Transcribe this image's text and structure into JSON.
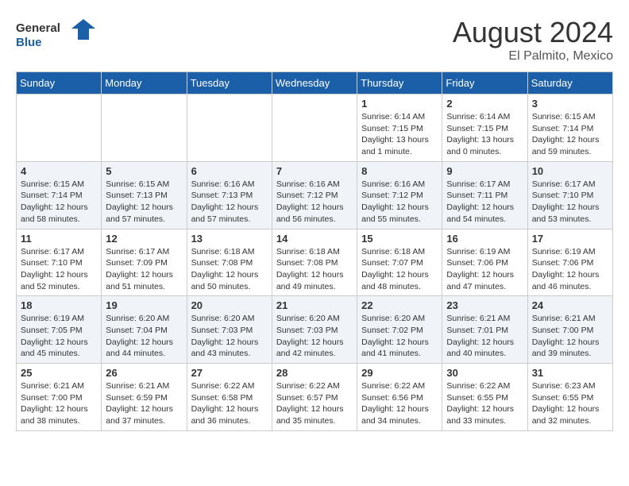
{
  "header": {
    "logo_text_general": "General",
    "logo_text_blue": "Blue",
    "month_year": "August 2024",
    "location": "El Palmito, Mexico"
  },
  "weekdays": [
    "Sunday",
    "Monday",
    "Tuesday",
    "Wednesday",
    "Thursday",
    "Friday",
    "Saturday"
  ],
  "weeks": [
    [
      {
        "day": "",
        "sunrise": "",
        "sunset": "",
        "daylight": ""
      },
      {
        "day": "",
        "sunrise": "",
        "sunset": "",
        "daylight": ""
      },
      {
        "day": "",
        "sunrise": "",
        "sunset": "",
        "daylight": ""
      },
      {
        "day": "",
        "sunrise": "",
        "sunset": "",
        "daylight": ""
      },
      {
        "day": "1",
        "sunrise": "Sunrise: 6:14 AM",
        "sunset": "Sunset: 7:15 PM",
        "daylight": "Daylight: 13 hours and 1 minute."
      },
      {
        "day": "2",
        "sunrise": "Sunrise: 6:14 AM",
        "sunset": "Sunset: 7:15 PM",
        "daylight": "Daylight: 13 hours and 0 minutes."
      },
      {
        "day": "3",
        "sunrise": "Sunrise: 6:15 AM",
        "sunset": "Sunset: 7:14 PM",
        "daylight": "Daylight: 12 hours and 59 minutes."
      }
    ],
    [
      {
        "day": "4",
        "sunrise": "Sunrise: 6:15 AM",
        "sunset": "Sunset: 7:14 PM",
        "daylight": "Daylight: 12 hours and 58 minutes."
      },
      {
        "day": "5",
        "sunrise": "Sunrise: 6:15 AM",
        "sunset": "Sunset: 7:13 PM",
        "daylight": "Daylight: 12 hours and 57 minutes."
      },
      {
        "day": "6",
        "sunrise": "Sunrise: 6:16 AM",
        "sunset": "Sunset: 7:13 PM",
        "daylight": "Daylight: 12 hours and 57 minutes."
      },
      {
        "day": "7",
        "sunrise": "Sunrise: 6:16 AM",
        "sunset": "Sunset: 7:12 PM",
        "daylight": "Daylight: 12 hours and 56 minutes."
      },
      {
        "day": "8",
        "sunrise": "Sunrise: 6:16 AM",
        "sunset": "Sunset: 7:12 PM",
        "daylight": "Daylight: 12 hours and 55 minutes."
      },
      {
        "day": "9",
        "sunrise": "Sunrise: 6:17 AM",
        "sunset": "Sunset: 7:11 PM",
        "daylight": "Daylight: 12 hours and 54 minutes."
      },
      {
        "day": "10",
        "sunrise": "Sunrise: 6:17 AM",
        "sunset": "Sunset: 7:10 PM",
        "daylight": "Daylight: 12 hours and 53 minutes."
      }
    ],
    [
      {
        "day": "11",
        "sunrise": "Sunrise: 6:17 AM",
        "sunset": "Sunset: 7:10 PM",
        "daylight": "Daylight: 12 hours and 52 minutes."
      },
      {
        "day": "12",
        "sunrise": "Sunrise: 6:17 AM",
        "sunset": "Sunset: 7:09 PM",
        "daylight": "Daylight: 12 hours and 51 minutes."
      },
      {
        "day": "13",
        "sunrise": "Sunrise: 6:18 AM",
        "sunset": "Sunset: 7:08 PM",
        "daylight": "Daylight: 12 hours and 50 minutes."
      },
      {
        "day": "14",
        "sunrise": "Sunrise: 6:18 AM",
        "sunset": "Sunset: 7:08 PM",
        "daylight": "Daylight: 12 hours and 49 minutes."
      },
      {
        "day": "15",
        "sunrise": "Sunrise: 6:18 AM",
        "sunset": "Sunset: 7:07 PM",
        "daylight": "Daylight: 12 hours and 48 minutes."
      },
      {
        "day": "16",
        "sunrise": "Sunrise: 6:19 AM",
        "sunset": "Sunset: 7:06 PM",
        "daylight": "Daylight: 12 hours and 47 minutes."
      },
      {
        "day": "17",
        "sunrise": "Sunrise: 6:19 AM",
        "sunset": "Sunset: 7:06 PM",
        "daylight": "Daylight: 12 hours and 46 minutes."
      }
    ],
    [
      {
        "day": "18",
        "sunrise": "Sunrise: 6:19 AM",
        "sunset": "Sunset: 7:05 PM",
        "daylight": "Daylight: 12 hours and 45 minutes."
      },
      {
        "day": "19",
        "sunrise": "Sunrise: 6:20 AM",
        "sunset": "Sunset: 7:04 PM",
        "daylight": "Daylight: 12 hours and 44 minutes."
      },
      {
        "day": "20",
        "sunrise": "Sunrise: 6:20 AM",
        "sunset": "Sunset: 7:03 PM",
        "daylight": "Daylight: 12 hours and 43 minutes."
      },
      {
        "day": "21",
        "sunrise": "Sunrise: 6:20 AM",
        "sunset": "Sunset: 7:03 PM",
        "daylight": "Daylight: 12 hours and 42 minutes."
      },
      {
        "day": "22",
        "sunrise": "Sunrise: 6:20 AM",
        "sunset": "Sunset: 7:02 PM",
        "daylight": "Daylight: 12 hours and 41 minutes."
      },
      {
        "day": "23",
        "sunrise": "Sunrise: 6:21 AM",
        "sunset": "Sunset: 7:01 PM",
        "daylight": "Daylight: 12 hours and 40 minutes."
      },
      {
        "day": "24",
        "sunrise": "Sunrise: 6:21 AM",
        "sunset": "Sunset: 7:00 PM",
        "daylight": "Daylight: 12 hours and 39 minutes."
      }
    ],
    [
      {
        "day": "25",
        "sunrise": "Sunrise: 6:21 AM",
        "sunset": "Sunset: 7:00 PM",
        "daylight": "Daylight: 12 hours and 38 minutes."
      },
      {
        "day": "26",
        "sunrise": "Sunrise: 6:21 AM",
        "sunset": "Sunset: 6:59 PM",
        "daylight": "Daylight: 12 hours and 37 minutes."
      },
      {
        "day": "27",
        "sunrise": "Sunrise: 6:22 AM",
        "sunset": "Sunset: 6:58 PM",
        "daylight": "Daylight: 12 hours and 36 minutes."
      },
      {
        "day": "28",
        "sunrise": "Sunrise: 6:22 AM",
        "sunset": "Sunset: 6:57 PM",
        "daylight": "Daylight: 12 hours and 35 minutes."
      },
      {
        "day": "29",
        "sunrise": "Sunrise: 6:22 AM",
        "sunset": "Sunset: 6:56 PM",
        "daylight": "Daylight: 12 hours and 34 minutes."
      },
      {
        "day": "30",
        "sunrise": "Sunrise: 6:22 AM",
        "sunset": "Sunset: 6:55 PM",
        "daylight": "Daylight: 12 hours and 33 minutes."
      },
      {
        "day": "31",
        "sunrise": "Sunrise: 6:23 AM",
        "sunset": "Sunset: 6:55 PM",
        "daylight": "Daylight: 12 hours and 32 minutes."
      }
    ]
  ]
}
